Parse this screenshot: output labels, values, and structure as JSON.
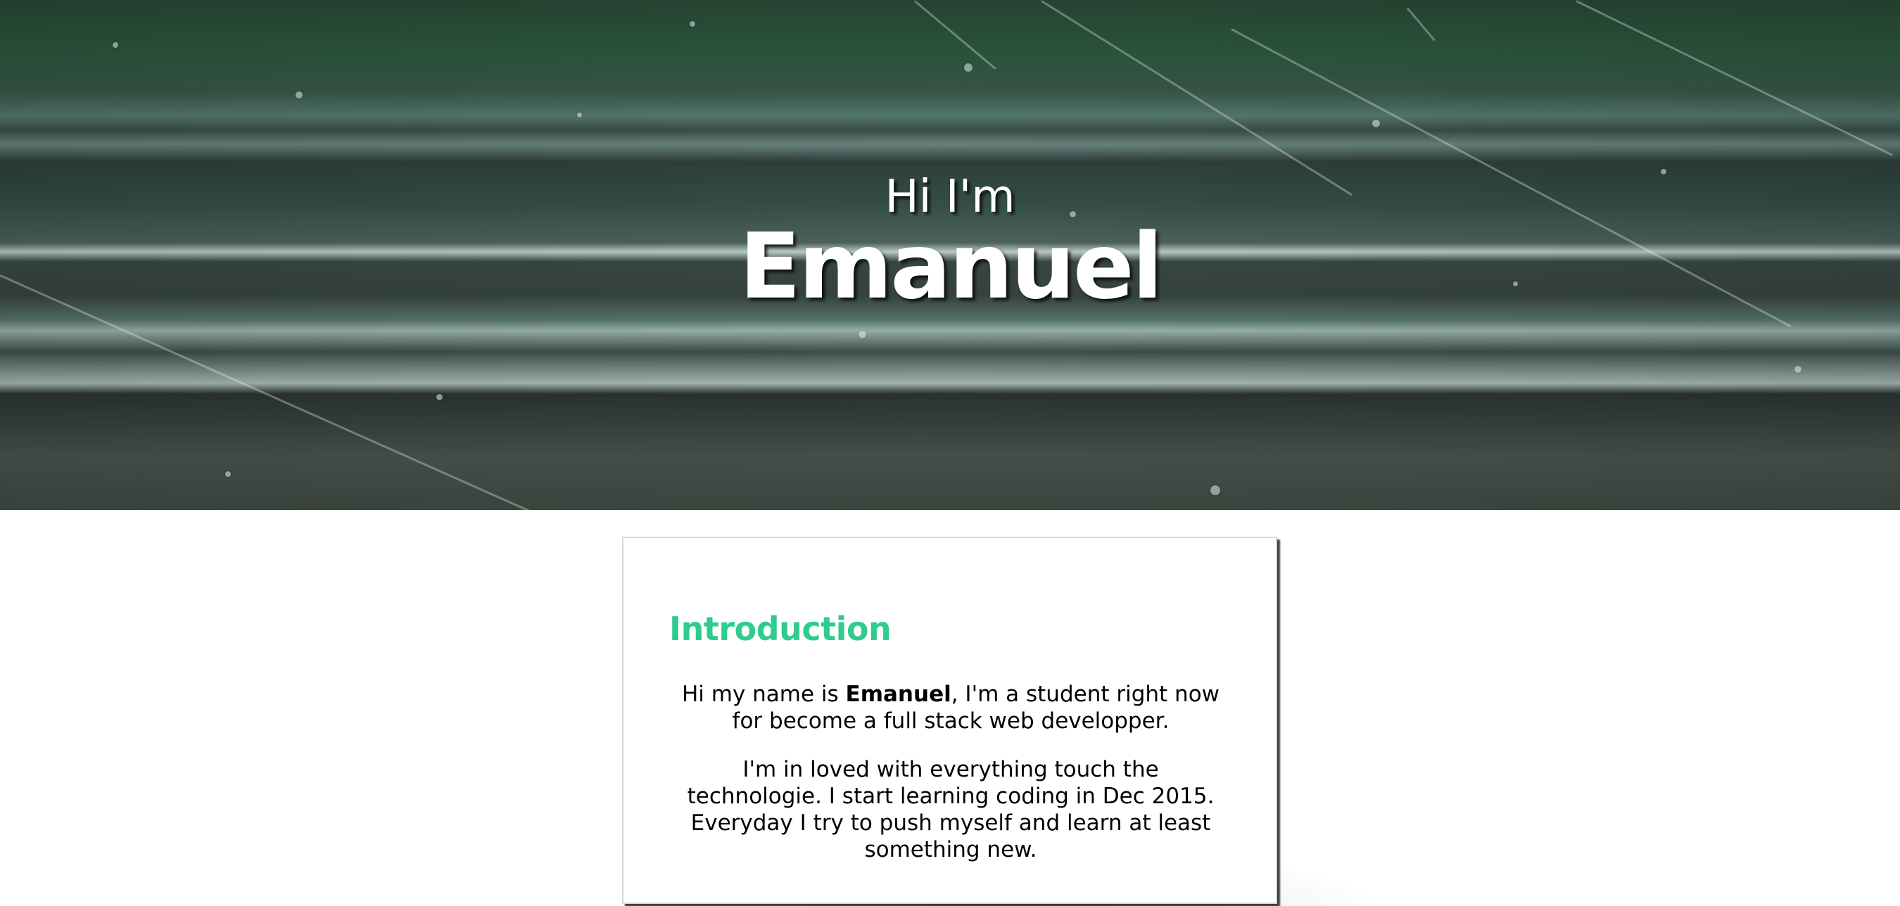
{
  "hero": {
    "greeting": "Hi I'm",
    "name": "Emanuel",
    "background": "rainy-window-railway-photo"
  },
  "intro": {
    "title": "Introduction",
    "paragraph1": {
      "before": "Hi my name is ",
      "bold": "Emanuel",
      "after": ", I'm a student right now for become a full stack web developper."
    },
    "paragraph2": "I'm in loved with everything touch the technologie. I start learning coding in Dec 2015. Everyday I try to push myself and learn at least something new."
  },
  "colors": {
    "accent": "#2ecc8e",
    "text": "#000000",
    "hero_text": "#ffffff"
  }
}
